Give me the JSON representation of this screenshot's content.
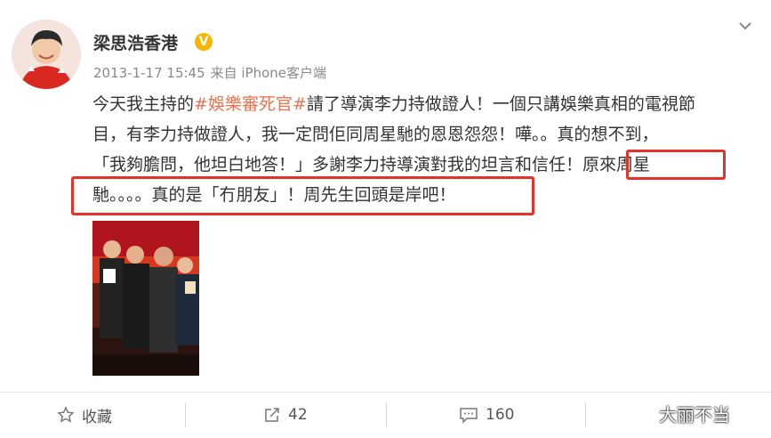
{
  "user": {
    "name": "梁思浩香港",
    "verified_badge": "V"
  },
  "meta": {
    "date": "2013-1-17 15:45",
    "source": "来自 iPhone客户端"
  },
  "post": {
    "line1_pre": "今天我主持的",
    "line1_tag": "#娛樂審死官#",
    "line1_post": "請了導演李力持做證人！一個只講娛樂真相的電視節",
    "line2": "目，有李力持做證人，我一定問佢同周星馳的恩恩怨怨！嘩。。真的想不到，",
    "line3": "「我夠膽問，他坦白地答！」多謝李力持導演對我的坦言和信任！原來周星",
    "line4": "馳。。。。真的是「冇朋友」！周先生回頭是岸吧！"
  },
  "actions": {
    "favorite": "收藏",
    "repost_count": "42",
    "comment_count": "160"
  },
  "watermark": "大丽不当",
  "colors": {
    "hashtag": "#eb7350",
    "highlight_box": "#e53128",
    "verified": "#f7b500"
  },
  "icons": [
    "more-icon",
    "star-icon",
    "share-icon",
    "comment-icon"
  ]
}
